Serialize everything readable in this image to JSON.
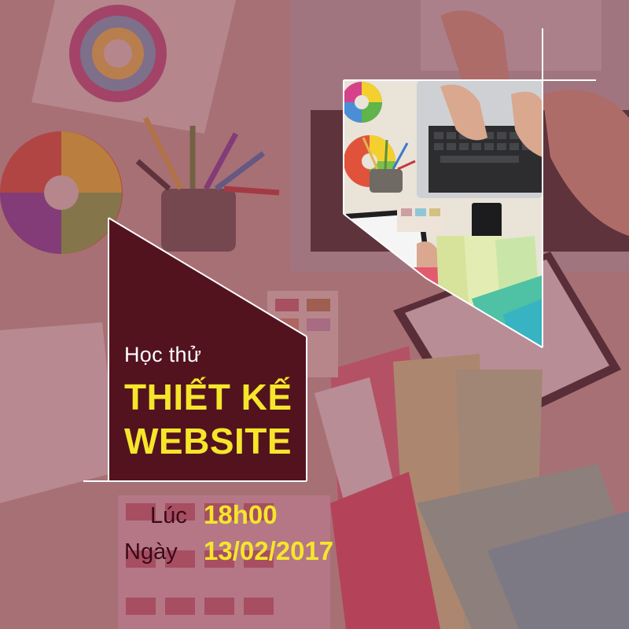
{
  "headline": {
    "intro": "Học thử",
    "title_line_1": "THIẾT KẾ",
    "title_line_2": "WEBSITE"
  },
  "schedule": {
    "time_label": "Lúc",
    "time_value": "18h00",
    "date_label": "Ngày",
    "date_value": "13/02/2017"
  },
  "colors": {
    "panel": "#52131f",
    "accent_yellow": "#f5e62b",
    "overlay": "#8a3a4a",
    "frame_lines": "#ffffff"
  }
}
